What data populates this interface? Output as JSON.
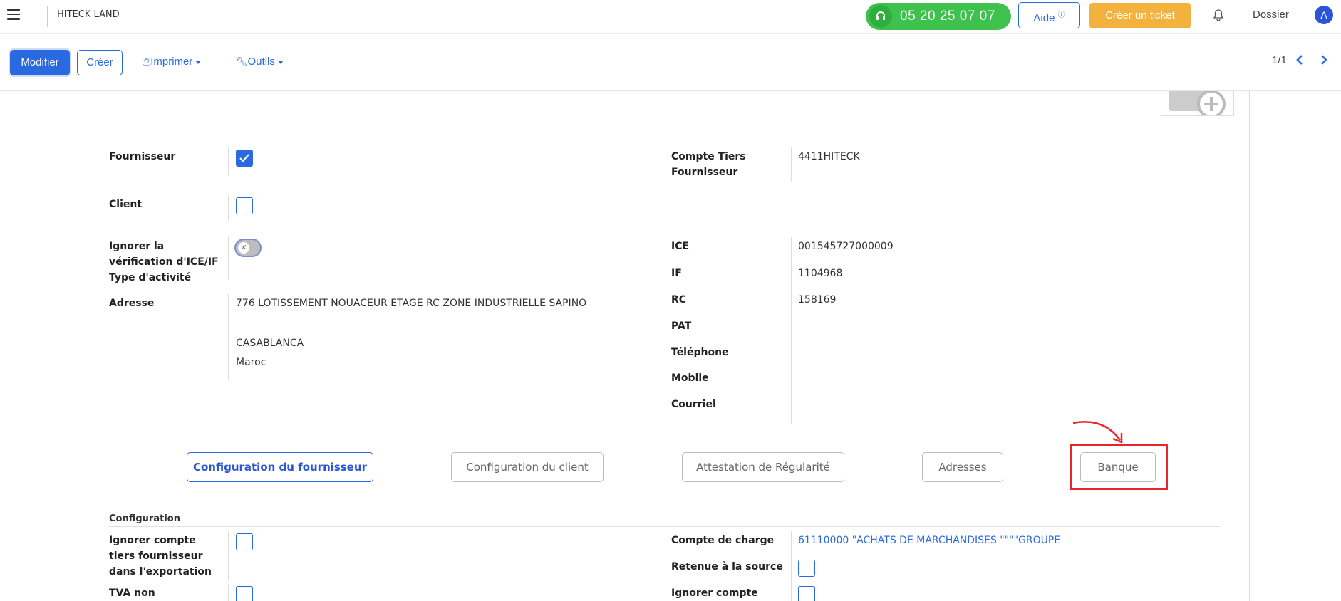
{
  "topbar": {
    "company": "HITECK LAND",
    "phone": "05 20 25 07 07",
    "aide_label": "Aide",
    "aide_icon": "question-circle-icon",
    "ticket_label": "Créer un ticket",
    "dossier_label": "Dossier",
    "avatar_letter": "A"
  },
  "controlbar": {
    "modifier_label": "Modifier",
    "creer_label": "Créer",
    "imprimer_label": "Imprimer",
    "outils_label": "Outils",
    "pager": "1/1"
  },
  "form": {
    "fournisseur": {
      "label": "Fournisseur",
      "checked": true
    },
    "client": {
      "label": "Client",
      "checked": false
    },
    "ignorer_ice": {
      "label_line1": "Ignorer la",
      "label_line2": "vérification d'ICE/IF"
    },
    "type_activite": {
      "label": "Type d'activité"
    },
    "adresse": {
      "label": "Adresse",
      "line1": "776 LOTISSEMENT NOUACEUR ETAGE RC ZONE INDUSTRIELLE SAPINO",
      "city": "CASABLANCA",
      "country": "Maroc"
    },
    "compte_tiers": {
      "label_line1": "Compte Tiers",
      "label_line2": "Fournisseur",
      "value": "4411HITECK"
    },
    "ice": {
      "label": "ICE",
      "value": "001545727000009"
    },
    "if": {
      "label": "IF",
      "value": "1104968"
    },
    "rc": {
      "label": "RC",
      "value": "158169"
    },
    "pat": {
      "label": "PAT"
    },
    "telephone": {
      "label": "Téléphone"
    },
    "mobile": {
      "label": "Mobile"
    },
    "courriel": {
      "label": "Courriel"
    }
  },
  "tabs": [
    {
      "label": "Configuration du fournisseur",
      "active": true
    },
    {
      "label": "Configuration du client",
      "active": false
    },
    {
      "label": "Attestation de Régularité",
      "active": false
    },
    {
      "label": "Adresses",
      "active": false
    },
    {
      "label": "Banque",
      "active": false
    }
  ],
  "configuration": {
    "title": "Configuration",
    "ignorer_compte": {
      "line1": "Ignorer compte",
      "line2": "tiers fournisseur",
      "line3": "dans l'exportation"
    },
    "tva_non": {
      "label": "TVA non"
    },
    "compte_charge": {
      "label": "Compte de charge",
      "value": "61110000 \"ACHATS DE MARCHANDISES \"\"\"\"GROUPE"
    },
    "retenue": {
      "label": "Retenue à la source"
    },
    "ignorer_compte_right": {
      "label": "Ignorer compte"
    }
  },
  "colors": {
    "primary": "#2a6ae0",
    "green": "#3ec24d",
    "orange": "#f2b23d",
    "highlight": "#e8262a"
  }
}
